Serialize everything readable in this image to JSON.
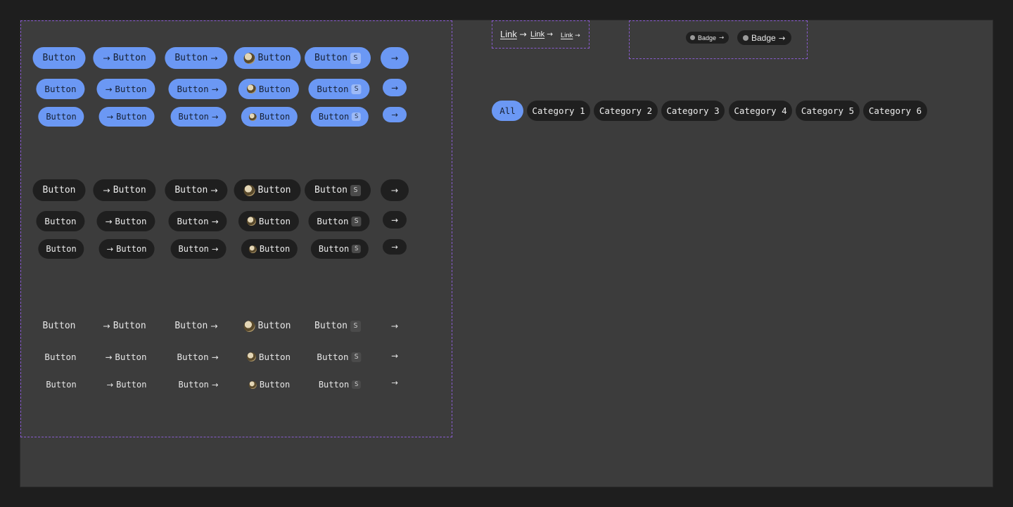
{
  "button_label": "Button",
  "shortcut_key": "S",
  "arrow_glyph": "→",
  "button_variants": [
    {
      "name": "primary",
      "color": "#6b98f4"
    },
    {
      "name": "secondary",
      "color": "#1f1f1f"
    },
    {
      "name": "ghost",
      "color": "transparent"
    }
  ],
  "button_types": [
    "text",
    "leading-arrow",
    "trailing-arrow",
    "avatar",
    "shortcut",
    "icon-only"
  ],
  "button_sizes": [
    "lg",
    "md",
    "sm"
  ],
  "links": [
    {
      "label": "Link",
      "size": "lg"
    },
    {
      "label": "Link",
      "size": "md"
    },
    {
      "label": "Link",
      "size": "sm"
    }
  ],
  "badges": [
    {
      "label": "Badge",
      "size": "sm"
    },
    {
      "label": "Badge",
      "size": "md"
    }
  ],
  "categories": {
    "active": "All",
    "items": [
      "All",
      "Category 1",
      "Category 2",
      "Category 3",
      "Category 4",
      "Category 5",
      "Category 6"
    ]
  },
  "colors": {
    "background": "#1e1e1e",
    "canvas": "#3c3c3c",
    "accent": "#6b98f4",
    "frame_border": "#8a5cd0"
  }
}
